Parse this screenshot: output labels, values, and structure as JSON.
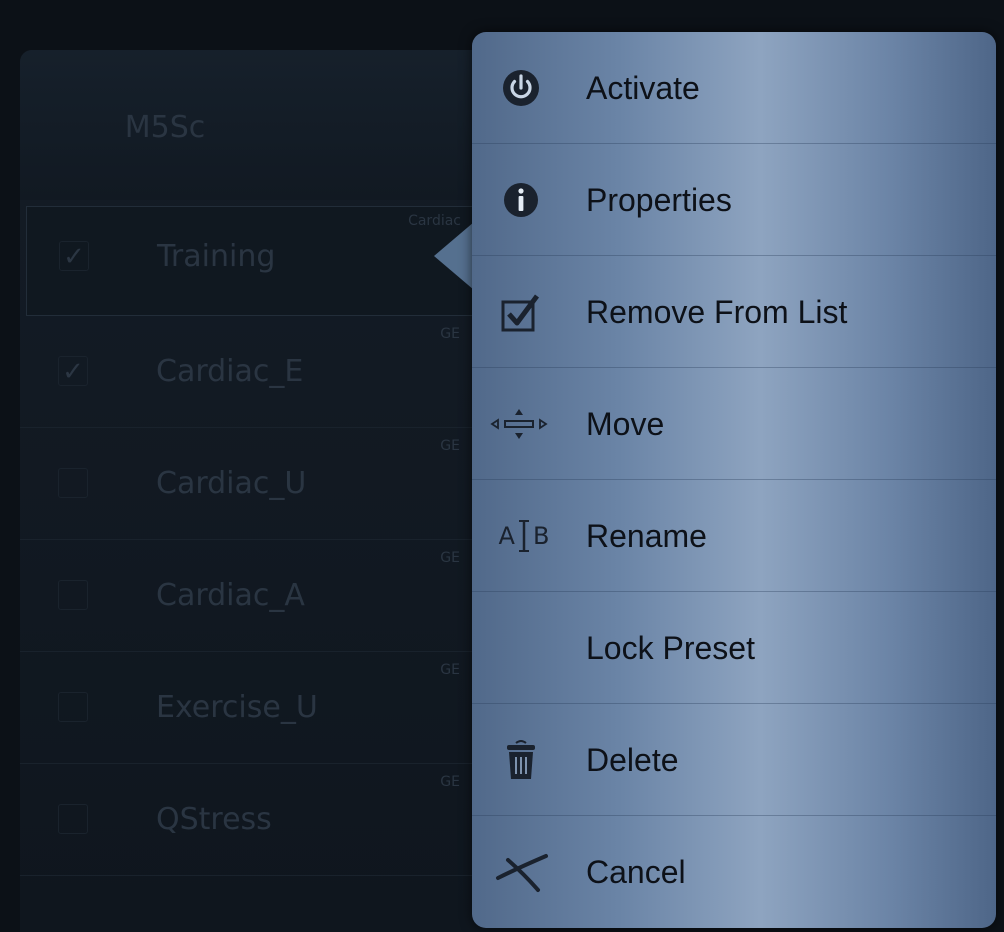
{
  "panel": {
    "title": "M5Sc",
    "rows": [
      {
        "name": "Training",
        "tag": "Cardiac",
        "checked": true
      },
      {
        "name": "Cardiac_E",
        "tag": "GE",
        "checked": true
      },
      {
        "name": "Cardiac_U",
        "tag": "GE",
        "checked": false
      },
      {
        "name": "Cardiac_A",
        "tag": "GE",
        "checked": false
      },
      {
        "name": "Exercise_U",
        "tag": "GE",
        "checked": false
      },
      {
        "name": "QStress",
        "tag": "GE",
        "checked": false
      }
    ],
    "check_mark": "✓"
  },
  "menu": {
    "items": [
      {
        "label": "Activate",
        "icon": "power-icon"
      },
      {
        "label": "Properties",
        "icon": "info-icon"
      },
      {
        "label": "Remove From List",
        "icon": "checkbox-icon"
      },
      {
        "label": "Move",
        "icon": "move-arrows-icon"
      },
      {
        "label": "Rename",
        "icon": "rename-cursor-icon"
      },
      {
        "label": "Lock Preset",
        "icon": ""
      },
      {
        "label": "Delete",
        "icon": "trash-icon"
      },
      {
        "label": "Cancel",
        "icon": "cancel-icon"
      }
    ],
    "rename_icon_text": {
      "left": "A",
      "right": "B"
    }
  },
  "colors": {
    "menu_text": "#0d1118",
    "icon": "#1a222e",
    "panel_text": "#2a3542"
  }
}
